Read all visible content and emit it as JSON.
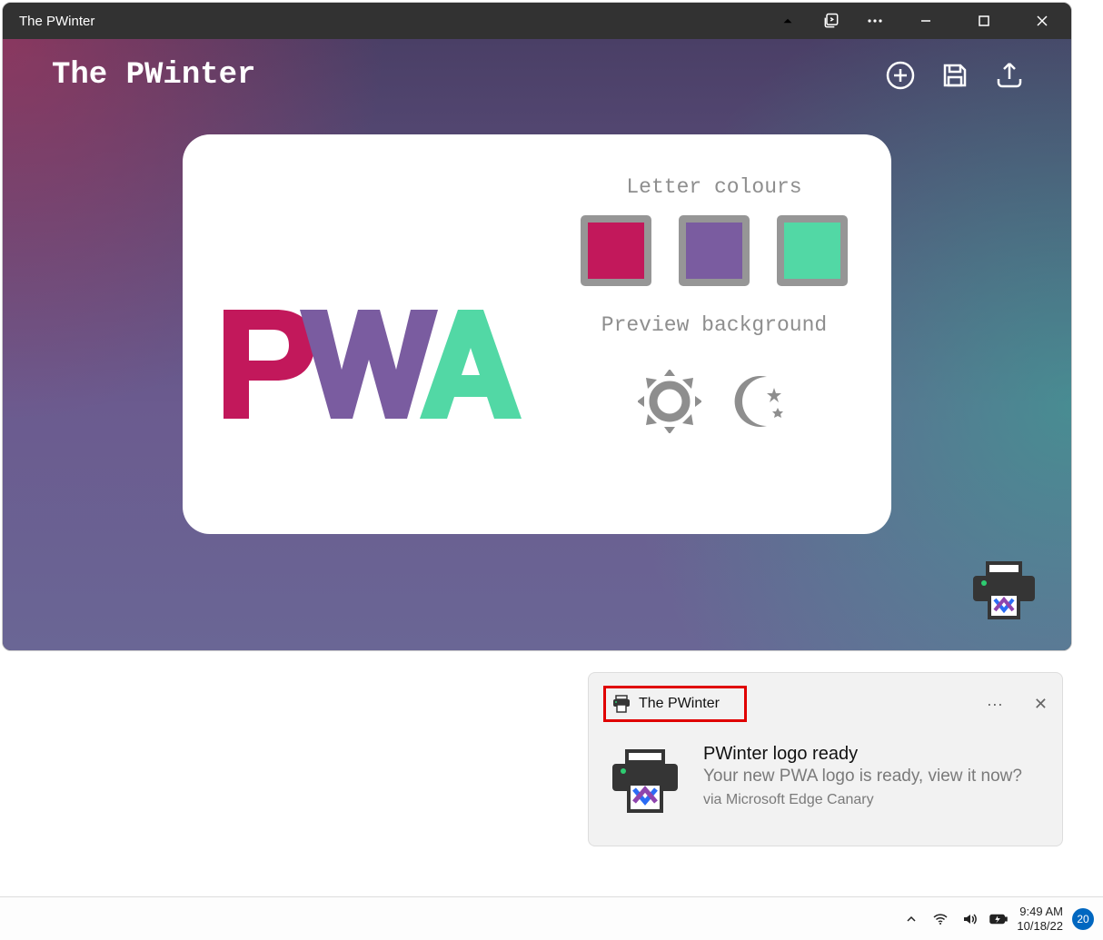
{
  "window": {
    "title": "The PWinter",
    "app_title": "The PWinter"
  },
  "labels": {
    "letter_colours": "Letter colours",
    "preview_background": "Preview background"
  },
  "colors": {
    "p": "#c2185b",
    "w": "#7a5ca0",
    "a": "#52d8a5"
  },
  "notification": {
    "app": "The PWinter",
    "title": "PWinter logo ready",
    "subtitle": "Your new PWA logo is ready, view it now?",
    "via": "via Microsoft Edge Canary",
    "more": "···",
    "close": "✕"
  },
  "taskbar": {
    "time": "9:49 AM",
    "date": "10/18/22",
    "badge": "20"
  }
}
